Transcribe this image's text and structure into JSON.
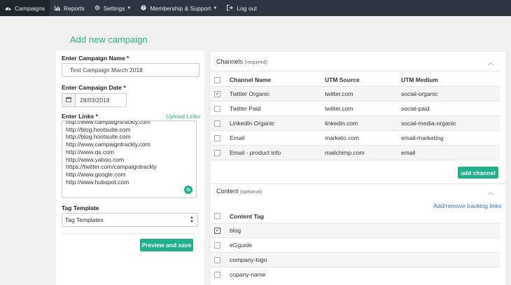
{
  "nav": {
    "items": [
      {
        "label": "Campaigns",
        "icon": "dashboard-icon"
      },
      {
        "label": "Reports",
        "icon": "bar-chart-icon"
      },
      {
        "label": "Settings",
        "icon": "gear-icon"
      },
      {
        "label": "Membership & Support",
        "icon": "help-icon"
      },
      {
        "label": "Log out",
        "icon": "logout-icon"
      }
    ]
  },
  "page": {
    "title": "Add new campaign"
  },
  "form": {
    "name_label": "Enter Campaign Name *",
    "name_value": "Test Campaign March 2018",
    "date_label": "Enter Campaign Date *",
    "date_value": "28/03/2018",
    "links_label": "Enter Links *",
    "upload_label": "Upload Links",
    "links": [
      "http://www.campaigntrackly.com",
      "http://blog.hootsuite.com",
      "http://blog.hootsuite.com",
      "http://www.campaigntrackly.com",
      "http://www.qs.com",
      "http://www.yahoo.com",
      "https://twitter.com/campaigntrackly",
      "http://www.google.com",
      "http://www.hubspot.com"
    ],
    "template_label": "Tag Template",
    "template_value": "Tag Templates",
    "preview_button": "Preview and save"
  },
  "channels": {
    "title": "Channels",
    "subtitle": "(required)",
    "columns": [
      "Channel Name",
      "UTM Source",
      "UTM Medium"
    ],
    "rows": [
      {
        "name": "Twitter Organic",
        "source": "twitter.com",
        "medium": "social-organic",
        "checked": true
      },
      {
        "name": "Twitter Paid",
        "source": "twitter.com",
        "medium": "social-paid",
        "checked": false
      },
      {
        "name": "LinkedIn Organic",
        "source": "linkedin.com",
        "medium": "social-media-organic",
        "checked": false
      },
      {
        "name": "Email",
        "source": "marketo.com",
        "medium": "email-marketing",
        "checked": false
      },
      {
        "name": "Email - product info",
        "source": "mailchimp.com",
        "medium": "email",
        "checked": false
      }
    ],
    "add_button": "add channel"
  },
  "content": {
    "title": "Content",
    "subtitle": "(optional)",
    "manage_link": "Add/remove tracking links",
    "column": "Content Tag",
    "rows": [
      {
        "tag": "blog",
        "checked": true
      },
      {
        "tag": "eGguide",
        "checked": false
      },
      {
        "tag": "company-logo",
        "checked": false
      },
      {
        "tag": "copany-name",
        "checked": false
      }
    ]
  },
  "colors": {
    "accent": "#22b08a",
    "nav_bg": "#2c3540",
    "link": "#3a6fb0"
  }
}
